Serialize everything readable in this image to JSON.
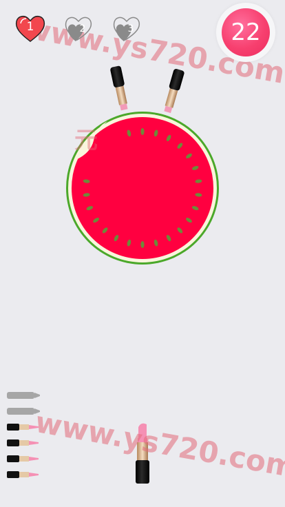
{
  "hud": {
    "lives": [
      {
        "label": "1",
        "state": "active"
      },
      {
        "label": "2",
        "state": "inactive"
      },
      {
        "label": "3",
        "state": "inactive"
      }
    ],
    "score": "22"
  },
  "target": {
    "type": "watermelon",
    "stuck_lipsticks": 2
  },
  "ammo": {
    "used": 2,
    "remaining": 4
  },
  "watermark": {
    "line1": "www.ys720.com",
    "line2": "www.ys720.com",
    "cn_text": "元"
  },
  "colors": {
    "background": "#ebebef",
    "score_bubble": "#f7406f",
    "heart_active": "#f2474e",
    "heart_inactive": "#8a8a8a",
    "melon_red": "#ff0040",
    "melon_rind": "#4ba82a",
    "lipstick_tube": "#111111",
    "lipstick_pink": "#f590b4",
    "ammo_used": "#a6a6a6"
  }
}
